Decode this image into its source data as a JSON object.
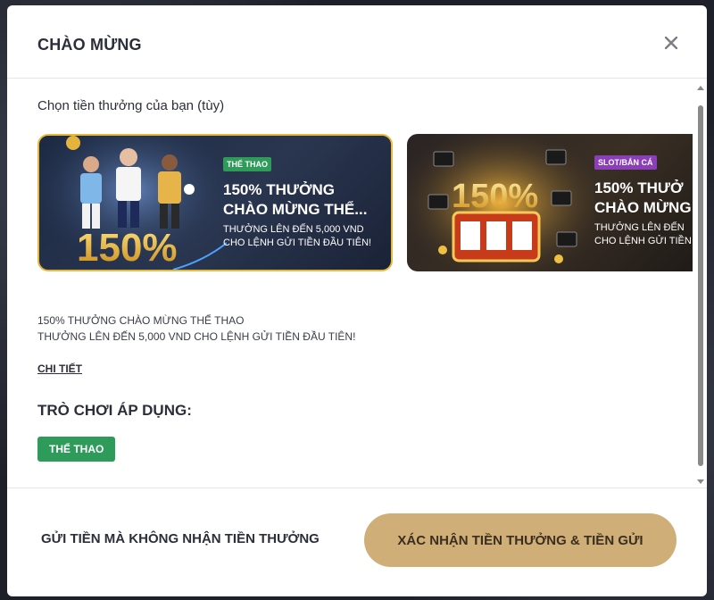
{
  "modal": {
    "title": "CHÀO MỪNG",
    "close_icon": "close-icon"
  },
  "bonus": {
    "section_label": "Chọn tiền thưởng của bạn (tùy)",
    "cards": [
      {
        "badge": "THỂ THAO",
        "badge_color": "#2e9b5b",
        "title_line1": "150% THƯỞNG",
        "title_line2": "CHÀO MỪNG THỂ...",
        "sub_line1": "THƯỞNG LÊN ĐẾN 5,000 VND",
        "sub_line2": "CHO LỆNH GỬI TIỀN ĐẦU TIÊN!",
        "art_text": "150%",
        "selected": true
      },
      {
        "badge": "SLOT/BẮN CÁ",
        "badge_color": "#8a3fb8",
        "title_line1": "150% THƯỞ",
        "title_line2": "CHÀO MỪNG",
        "sub_line1": "THƯỞNG LÊN ĐẾN",
        "sub_line2": "CHO LỆNH GỬI TIỀN",
        "art_text": "150%",
        "selected": false
      }
    ],
    "description_line1": "150% THƯỞNG CHÀO MỪNG THỂ THAO",
    "description_line2": "THƯỞNG LÊN ĐẾN 5,000 VND CHO LỆNH GỬI TIỀN ĐẦU TIÊN!",
    "details_link": "CHI TIẾT",
    "games_title": "TRÒ CHƠI ÁP DỤNG:",
    "game_tag": "THỂ THAO"
  },
  "footer": {
    "skip_label": "GỬI TIỀN MÀ KHÔNG NHẬN TIỀN THƯỞNG",
    "confirm_label": "XÁC NHẬN TIỀN THƯỞNG & TIỀN GỬI"
  },
  "colors": {
    "accent_gold": "#cfae77",
    "tag_green": "#2e9b5b",
    "selected_border": "#e5b93b"
  }
}
